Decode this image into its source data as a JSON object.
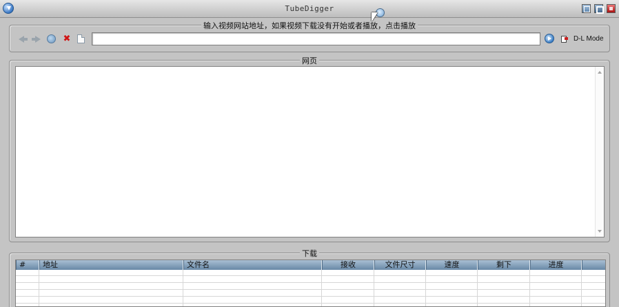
{
  "window": {
    "title": "TubeDigger"
  },
  "url_bar": {
    "legend": "输入视频网站地址，如果视频下载没有开始或者播放，点击播放",
    "url_value": "",
    "dl_mode_label": "D-L Mode",
    "icons": [
      "back-icon",
      "forward-icon",
      "refresh-icon",
      "stop-icon",
      "page-icon",
      "go-icon",
      "dl-mode-icon"
    ]
  },
  "web": {
    "legend": "网页"
  },
  "downloads": {
    "legend": "下载",
    "columns": [
      {
        "label": "#",
        "align": "left"
      },
      {
        "label": "地址",
        "align": "left"
      },
      {
        "label": "文件名",
        "align": "left"
      },
      {
        "label": "接收",
        "align": "center"
      },
      {
        "label": "文件尺寸",
        "align": "center"
      },
      {
        "label": "速度",
        "align": "center"
      },
      {
        "label": "剩下",
        "align": "center"
      },
      {
        "label": "进度",
        "align": "center"
      },
      {
        "label": "",
        "align": "center"
      }
    ]
  }
}
